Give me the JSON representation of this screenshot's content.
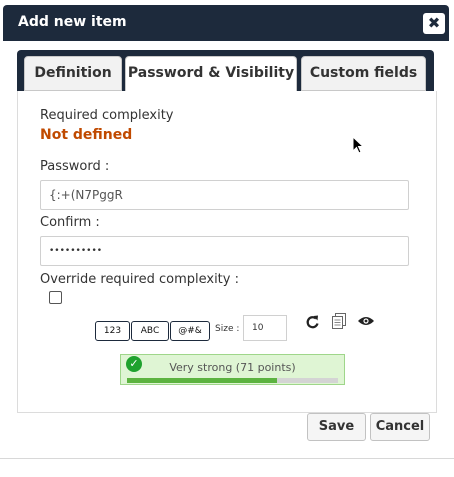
{
  "dialog": {
    "title": "Add new item",
    "close_label": "✖"
  },
  "tabs": [
    {
      "label": "Definition",
      "active": false
    },
    {
      "label": "Password & Visibility",
      "active": true
    },
    {
      "label": "Custom fields",
      "active": false
    }
  ],
  "form": {
    "required_complexity_label": "Required complexity",
    "required_complexity_value": "Not defined",
    "password_label": "Password :",
    "password_value": "{:+(N7PggR",
    "confirm_label": "Confirm :",
    "confirm_value": "••••••••••",
    "override_label": "Override required complexity :",
    "override_checked": false
  },
  "generator": {
    "charsets": [
      "123",
      "ABC",
      "@#&"
    ],
    "size_label": "Size :",
    "size_value": "10",
    "icons": [
      "refresh-icon",
      "copy-icon",
      "eye-icon"
    ]
  },
  "strength": {
    "text": "Very strong (71 points)",
    "fraction": 0.71,
    "color": "#5cb340"
  },
  "actions": {
    "save_label": "Save",
    "cancel_label": "Cancel"
  },
  "colors": {
    "titlebar": "#1d2a3c",
    "warning": "#c04a00"
  }
}
